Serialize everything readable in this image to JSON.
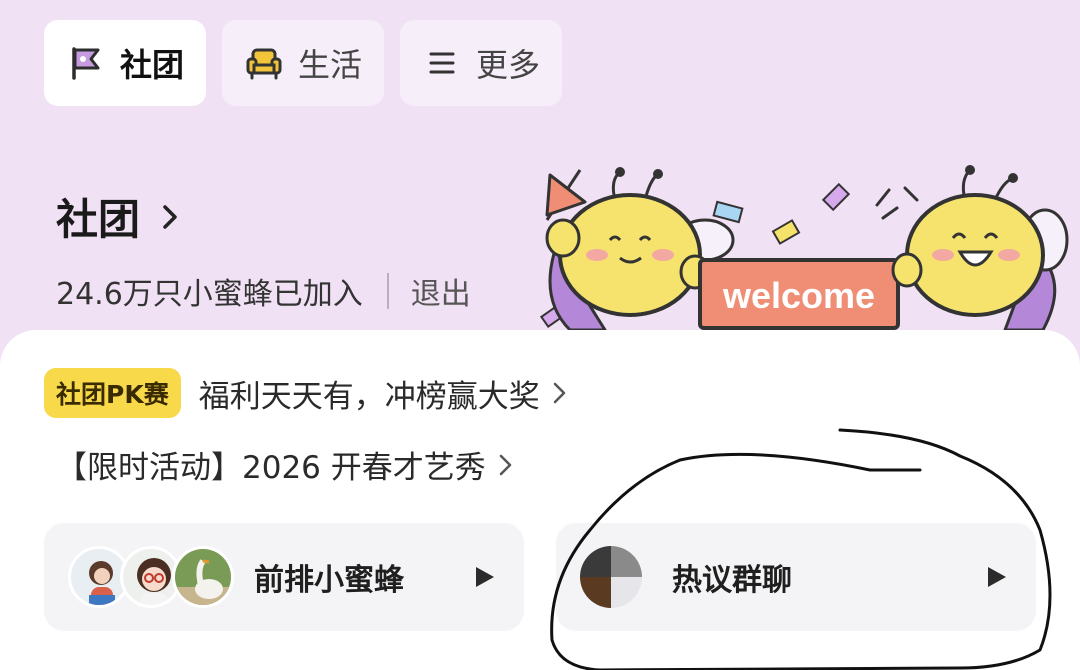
{
  "tabs": [
    {
      "label": "社团",
      "icon": "flag-icon",
      "active": true
    },
    {
      "label": "生活",
      "icon": "sofa-icon",
      "active": false
    },
    {
      "label": "更多",
      "icon": "menu-icon",
      "active": false
    }
  ],
  "header": {
    "title": "社团",
    "members": "24.6万只小蜜蜂已加入",
    "exit": "退出"
  },
  "banner": {
    "sign_text": "welcome"
  },
  "promos": {
    "pk_badge": "社团PK赛",
    "pk_text": "福利天天有，冲榜赢大奖",
    "event_text": "【限时活动】2026 开春才艺秀"
  },
  "cards": [
    {
      "label": "前排小蜜蜂",
      "icon": "play-icon"
    },
    {
      "label": "热议群聊",
      "icon": "play-icon"
    }
  ],
  "colors": {
    "background": "#f1e1f4",
    "badge": "#f7d94a",
    "accent": "#e9577a"
  }
}
